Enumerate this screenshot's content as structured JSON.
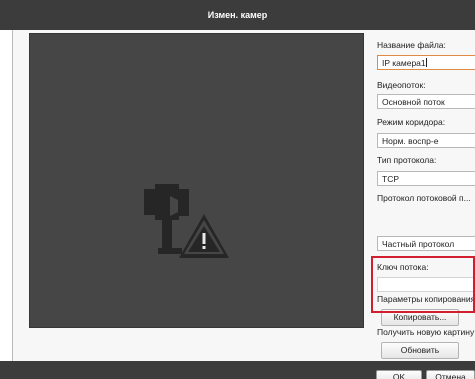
{
  "window": {
    "title": "Измен. камер"
  },
  "panel": {
    "filename_label": "Название файла:",
    "filename_value": "IP камера1",
    "stream_label": "Видеопоток:",
    "stream_value": "Основной поток",
    "corridor_label": "Режим коридора:",
    "corridor_value": "Норм. воспр-е",
    "protocol_label": "Тип протокола:",
    "protocol_value": "TCP",
    "stream_protocol_label": "Протокол потоковой п...",
    "stream_protocol_value": "Частный протокол",
    "stream_key_label": "Ключ потока:",
    "stream_key_value": "",
    "copy_params_label": "Параметры копирования:",
    "copy_button": "Копировать...",
    "snapshot_label": "Получить новую картину:",
    "refresh_button": "Обновить"
  },
  "footer": {
    "ok_button": "OK",
    "cancel_button": "Отмена"
  },
  "colors": {
    "preview_bg": "#464646",
    "highlight": "#d21f2f",
    "titlebar": "#3c3c3c",
    "focus_border": "#e08a44"
  },
  "icons": {
    "preview": "camera-offline-warning-icon",
    "dropdown": "chevron-down-icon"
  }
}
